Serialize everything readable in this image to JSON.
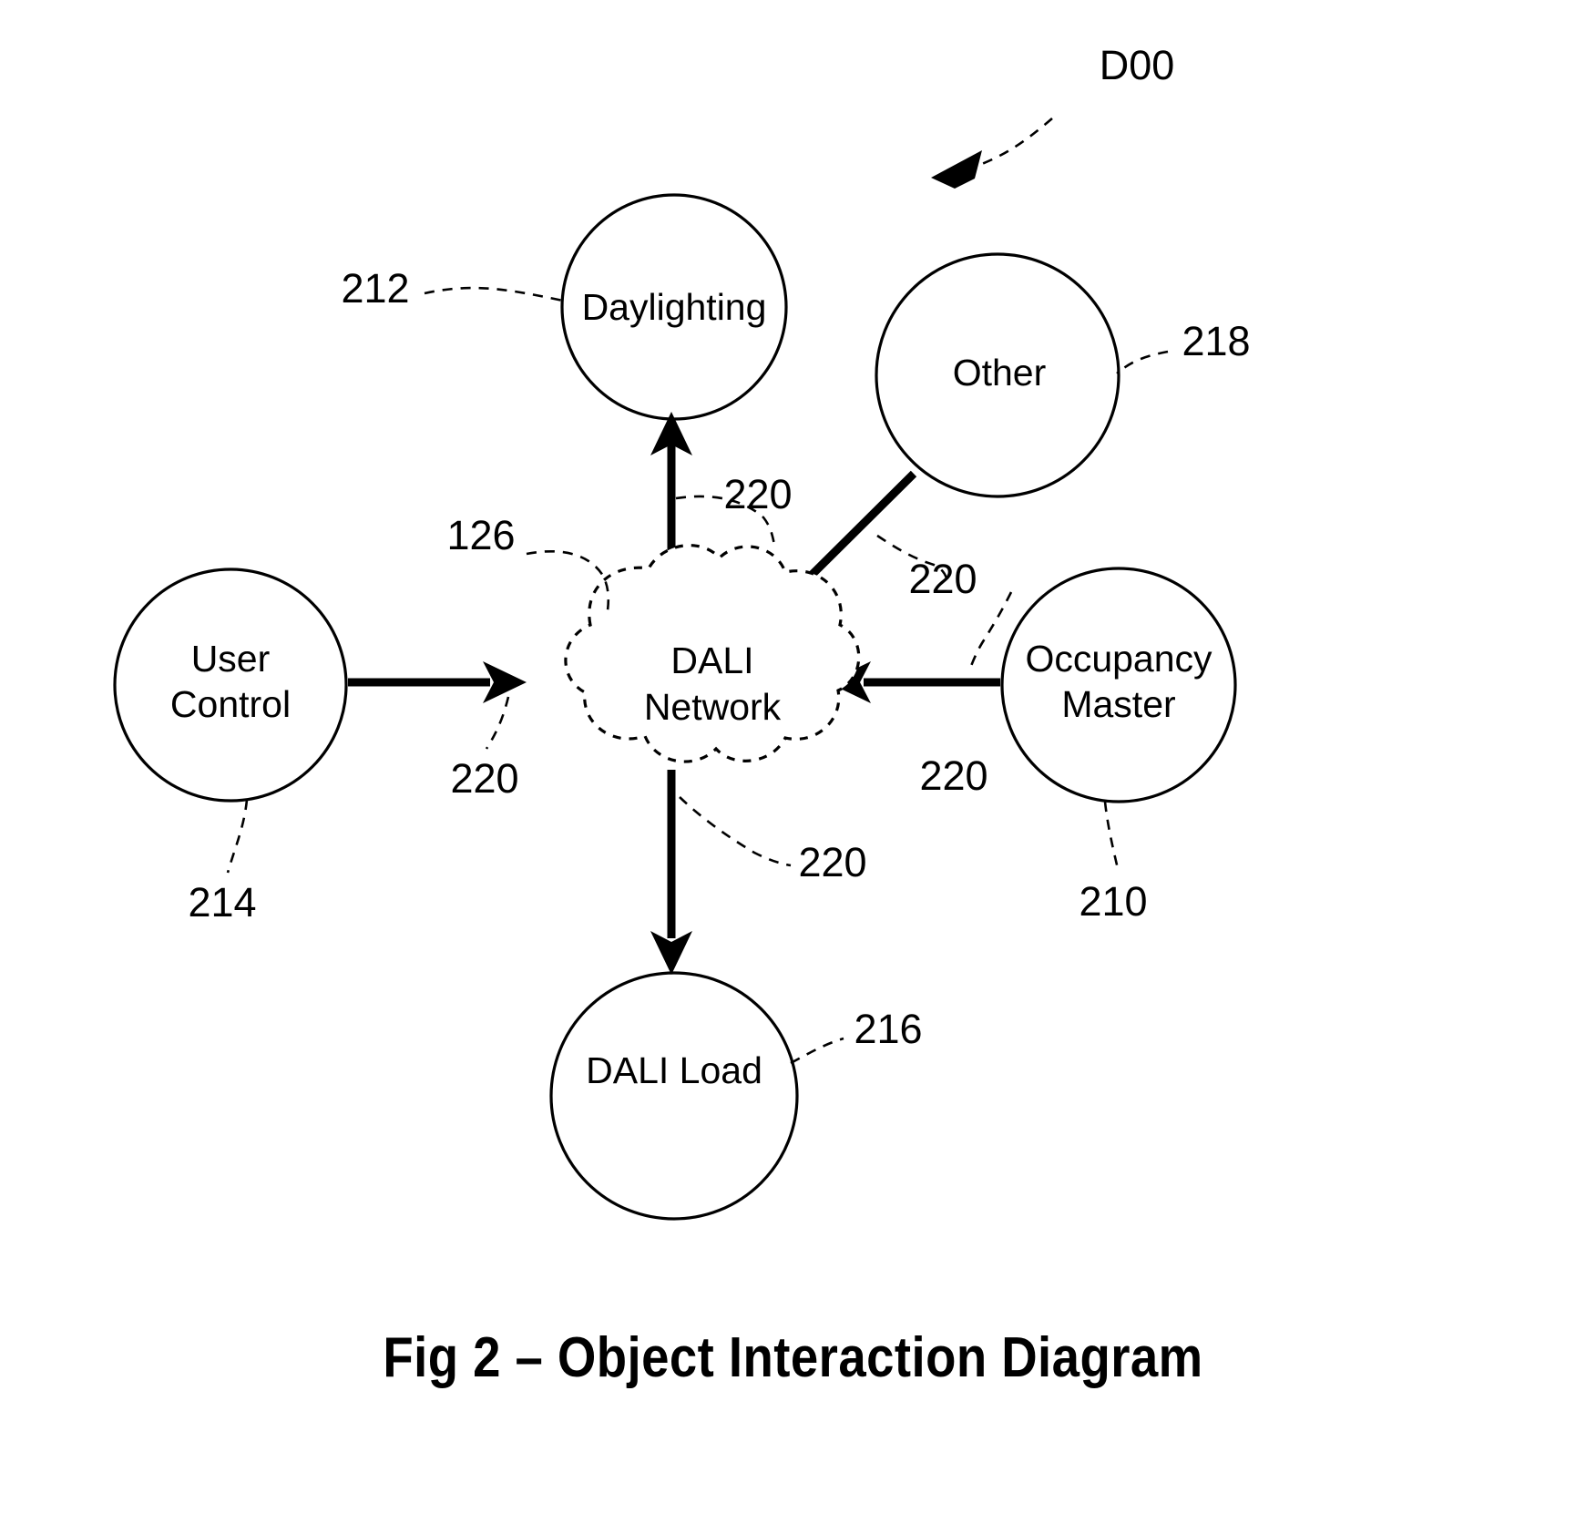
{
  "figure": {
    "caption": "Fig 2 – Object Interaction Diagram",
    "figure_ref": "D00"
  },
  "nodes": {
    "daylighting": {
      "label": "Daylighting",
      "ref": "212",
      "shape": "circle"
    },
    "other": {
      "label": "Other",
      "ref": "218",
      "shape": "circle"
    },
    "user_control": {
      "label_line1": "User",
      "label_line2": "Control",
      "ref": "214",
      "shape": "circle"
    },
    "occupancy_master": {
      "label_line1": "Occupancy",
      "label_line2": "Master",
      "ref": "210",
      "shape": "circle"
    },
    "dali_load": {
      "label": "DALI Load",
      "ref": "216",
      "shape": "circle"
    },
    "dali_network": {
      "label_line1": "DALI",
      "label_line2": "Network",
      "ref": "126",
      "shape": "cloud"
    }
  },
  "connections": [
    {
      "id": "daylighting-network",
      "ref": "220",
      "from": "daylighting",
      "to": "dali_network",
      "direction": "bidirectional"
    },
    {
      "id": "other-network",
      "ref": "220",
      "from": "other",
      "to": "dali_network",
      "direction": "to-network"
    },
    {
      "id": "usercontrol-network",
      "ref": "220",
      "from": "user_control",
      "to": "dali_network",
      "direction": "to-network"
    },
    {
      "id": "occupancy-network",
      "ref": "220",
      "from": "occupancy_master",
      "to": "dali_network",
      "direction": "to-network"
    },
    {
      "id": "network-daliload",
      "ref": "220",
      "from": "dali_network",
      "to": "dali_load",
      "direction": "to-load"
    }
  ],
  "colors": {
    "stroke": "#000000",
    "background": "#ffffff"
  }
}
